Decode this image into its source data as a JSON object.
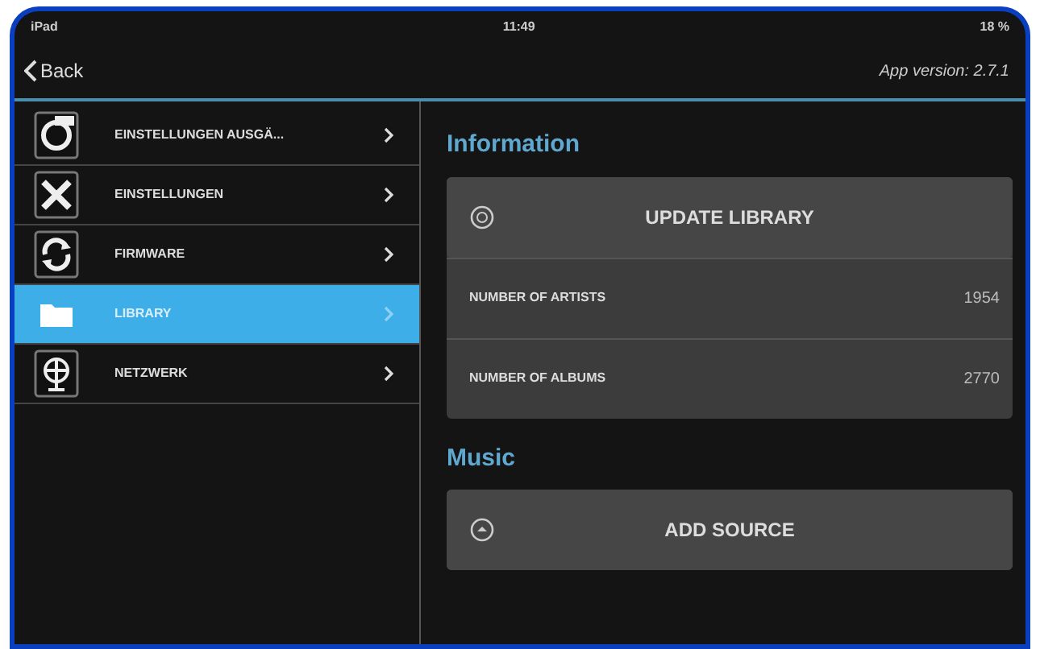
{
  "status_bar": {
    "device": "iPad",
    "time": "11:49",
    "battery": "18 %"
  },
  "nav": {
    "back": "Back",
    "version": "App version: 2.7.1"
  },
  "sidebar": {
    "items": [
      {
        "label": "EINSTELLUNGEN AUSGÄ...",
        "selected": false
      },
      {
        "label": "EINSTELLUNGEN",
        "selected": false
      },
      {
        "label": "FIRMWARE",
        "selected": false
      },
      {
        "label": "LIBRARY",
        "selected": true
      },
      {
        "label": "NETZWERK",
        "selected": false
      }
    ]
  },
  "sections": [
    {
      "title": "Information",
      "rows": [
        {
          "kind": "action",
          "label": "UPDATE LIBRARY"
        },
        {
          "kind": "stat",
          "label": "NUMBER OF ARTISTS",
          "value": "1954"
        },
        {
          "kind": "stat",
          "label": "NUMBER OF ALBUMS",
          "value": "2770"
        }
      ]
    },
    {
      "title": "Music",
      "rows": [
        {
          "kind": "action",
          "label": "ADD SOURCE"
        }
      ]
    }
  ]
}
